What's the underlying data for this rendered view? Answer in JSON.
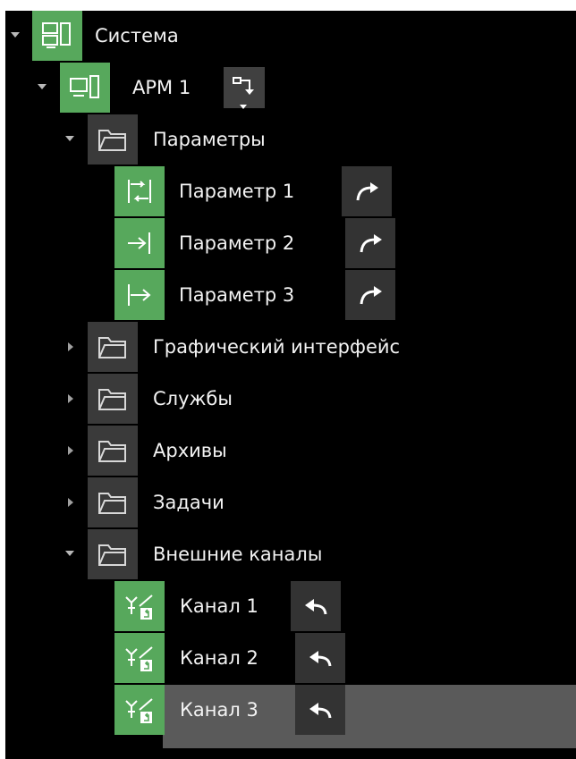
{
  "tree": {
    "root": {
      "label": "Система",
      "icon": "system-icon"
    },
    "workstation": {
      "label": "АРМ 1",
      "icon": "workstation-icon",
      "action_icon": "move-down-icon"
    },
    "parameters_folder": {
      "label": "Параметры",
      "icon": "folder-icon"
    },
    "parameters": [
      {
        "label": "Параметр 1",
        "icon": "bidirectional-parameter-icon",
        "action_icon": "forward-arrow-icon"
      },
      {
        "label": "Параметр 2",
        "icon": "input-parameter-icon",
        "action_icon": "forward-arrow-icon"
      },
      {
        "label": "Параметр 3",
        "icon": "output-parameter-icon",
        "action_icon": "forward-arrow-icon"
      }
    ],
    "folders": [
      {
        "label": "Графический интерфейс",
        "icon": "folder-icon",
        "expanded": false
      },
      {
        "label": "Службы",
        "icon": "folder-icon",
        "expanded": false
      },
      {
        "label": "Архивы",
        "icon": "folder-icon",
        "expanded": false
      },
      {
        "label": "Задачи",
        "icon": "folder-icon",
        "expanded": false
      }
    ],
    "channels_folder": {
      "label": "Внешние каналы",
      "icon": "folder-icon",
      "expanded": true
    },
    "channels": [
      {
        "label": "Канал 1",
        "icon": "channel-icon",
        "action_icon": "return-arrow-icon",
        "selected": false
      },
      {
        "label": "Канал 2",
        "icon": "channel-icon",
        "action_icon": "return-arrow-icon",
        "selected": false
      },
      {
        "label": "Канал 3",
        "icon": "channel-icon",
        "action_icon": "return-arrow-icon",
        "selected": true
      }
    ]
  },
  "colors": {
    "background": "#000000",
    "accent_green": "#57a85c",
    "folder_tile": "#3a3a3a",
    "selected_row": "#5a5a5a",
    "text": "#f3f3f3"
  }
}
